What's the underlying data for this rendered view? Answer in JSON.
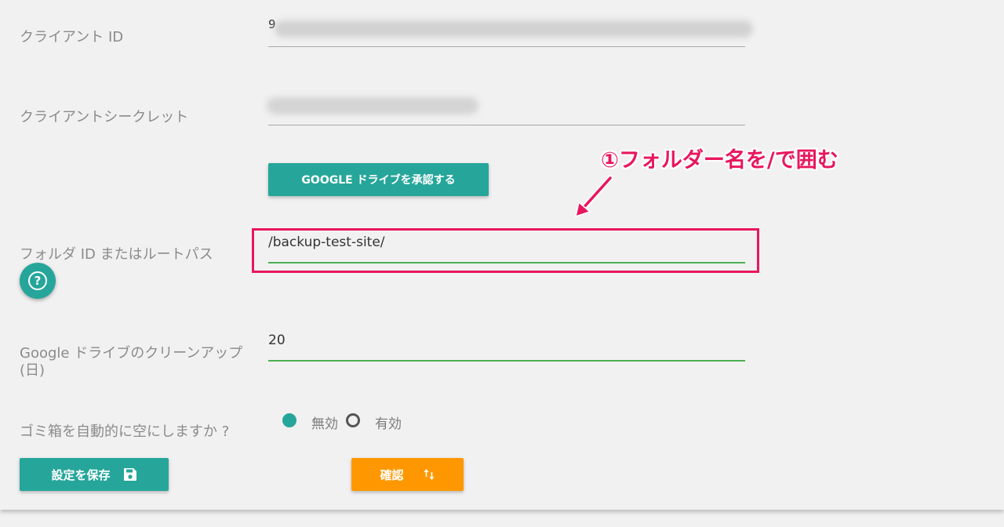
{
  "form": {
    "client_id": {
      "label": "クライアント ID",
      "value": "9",
      "blurred": true
    },
    "client_secret": {
      "label": "クライアントシークレット",
      "blurred": true
    },
    "authorize_button": {
      "label": "GOOGLE ドライブを承認する"
    },
    "folder": {
      "label": "フォルダ ID またはルートパス",
      "value": "/backup-test-site/",
      "help_icon": "question-circle-icon"
    },
    "cleanup": {
      "label": "Google ドライブのクリーンアップ (日)",
      "value": "20"
    },
    "trash": {
      "label": "ゴミ箱を自動的に空にしますか ?",
      "options": [
        {
          "label": "無効",
          "selected": true
        },
        {
          "label": "有効",
          "selected": false
        }
      ]
    }
  },
  "actions": {
    "save": {
      "label": "設定を保存",
      "icon": "floppy-disk-icon"
    },
    "confirm": {
      "label": "確認",
      "icon": "swap-vertical-icon"
    }
  },
  "annotation": {
    "text": "①フォルダー名を/で囲む",
    "color": "#e8175d"
  },
  "colors": {
    "teal": "#26a69a",
    "orange": "#ff9800",
    "focus_underline": "#4caf50"
  }
}
